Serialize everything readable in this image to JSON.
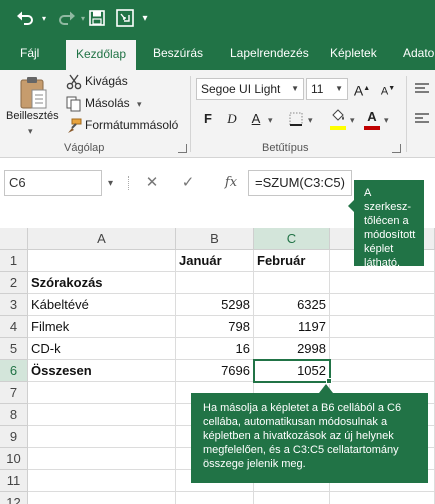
{
  "quick_access": {
    "undo_icon": "undo-icon",
    "redo_icon": "redo-icon",
    "save_icon": "save-icon",
    "touch_icon": "touch-mode-icon"
  },
  "ribbon_tabs": [
    "Fájl",
    "Kezdőlap",
    "Beszúrás",
    "Lapelrendezés",
    "Képletek",
    "Adato"
  ],
  "active_tab_index": 1,
  "clipboard_group": {
    "paste_label": "Beillesztés",
    "cut_label": "Kivágás",
    "copy_label": "Másolás",
    "format_painter_label": "Formátummásoló",
    "group_label": "Vágólap"
  },
  "font_group": {
    "font_name": "Segoe UI Light",
    "font_size": "11",
    "bold": "F",
    "italic": "D",
    "underline": "A",
    "grow": "A",
    "shrink": "A",
    "font_color_letter": "A",
    "fill_color": "#ffff00",
    "font_color": "#c00000",
    "group_label": "Betűtípus"
  },
  "formula_bar": {
    "name_box": "C6",
    "cancel_symbol": "✕",
    "enter_symbol": "✓",
    "fx_label": "fx",
    "formula": "=SZUM(C3:C5)"
  },
  "callouts": {
    "formula_tip": "A szerkesz-tőlécen a módosított képlet látható.",
    "copy_tip": "Ha másolja a képletet a B6 cellából a C6 cellába, automatikusan módosulnak a képletben a hivatkozások az új helynek megfelelően, és a C3:C5 cellatartomány összege jelenik meg."
  },
  "sheet": {
    "columns": [
      "A",
      "B",
      "C"
    ],
    "rows": [
      "1",
      "2",
      "3",
      "4",
      "5",
      "6",
      "7",
      "8",
      "9",
      "10",
      "11",
      "12"
    ],
    "cells": {
      "B1": "Január",
      "C1": "Február",
      "A2": "Szórakozás",
      "A3": "Kábeltévé",
      "B3": "5298",
      "C3": "6325",
      "A4": "Filmek",
      "B4": "798",
      "C4": "1197",
      "A5": "CD-k",
      "B5": "16",
      "C5": "2998",
      "A6": "Összesen",
      "B6": "7696",
      "C6": "1052"
    },
    "selected_cell": "C6",
    "accent_color": "#217346"
  }
}
